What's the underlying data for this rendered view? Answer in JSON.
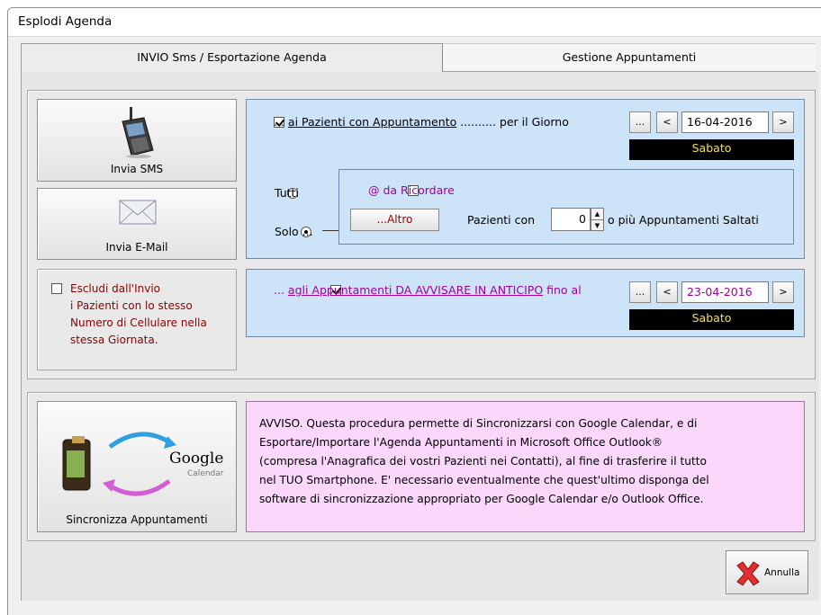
{
  "window": {
    "title": "Esplodi Agenda"
  },
  "tabs": [
    {
      "label": "INVIO Sms  /   Esportazione Agenda"
    },
    {
      "label": "Gestione Appuntamenti"
    }
  ],
  "send": {
    "sms_label": "Invia SMS",
    "email_label": "Invia E-Mail"
  },
  "exclude": {
    "lines": [
      "Escludi dall'Invio",
      "i Pazienti con lo stesso",
      "Numero di Cellulare nella",
      "stessa Giornata."
    ],
    "checked": false
  },
  "appointments": {
    "checked": true,
    "prefix": "... ",
    "link_text": "ai Pazienti con Appuntamento",
    "suffix": " .......... per il Giorno",
    "more_btn": "...",
    "prev_btn": "<",
    "date": "16-04-2016",
    "next_btn": ">",
    "day": "Sabato"
  },
  "filter": {
    "all_label": "Tutti",
    "only_label": "Solo ...",
    "selected": "only",
    "remind_label": "@ da Ricordare",
    "remind_checked": false,
    "altro_btn": "...Altro",
    "patients_with": "Pazienti con",
    "missed_count": "0",
    "missed_suffix": "o più Appuntamenti Saltati"
  },
  "advance": {
    "checked": true,
    "prefix": "... ",
    "link_text": "agli Appuntamenti DA AVVISARE IN ANTICIPO",
    "suffix": " fino al",
    "more_btn": "...",
    "prev_btn": "<",
    "date": "23-04-2016",
    "next_btn": ">",
    "day": "Sabato"
  },
  "sync": {
    "button_label": "Sincronizza Appuntamenti",
    "google_text": "Google",
    "calendar_text": "Calendar"
  },
  "notice": {
    "lines": [
      "AVVISO.  Questa procedura permette di Sincronizzarsi con Google Calendar, e di",
      "Esportare/Importare l'Agenda Appuntamenti in Microsoft Office Outlook®",
      "(compresa l'Anagrafica dei vostri Pazienti nei Contatti), al fine di trasferire il tutto",
      "nel TUO Smartphone. E' necessario eventualmente che quest'ultimo disponga del",
      "software di sincronizzazione appropriato per Google Calendar e/o Outlook Office."
    ]
  },
  "footer": {
    "cancel_label": "Annulla"
  },
  "colors": {
    "blue_panel": "#cde3f7",
    "pink_notice": "#fbd7fb",
    "link_purple": "#a000a0",
    "day_bg": "#000000",
    "day_text": "#f0e050"
  }
}
